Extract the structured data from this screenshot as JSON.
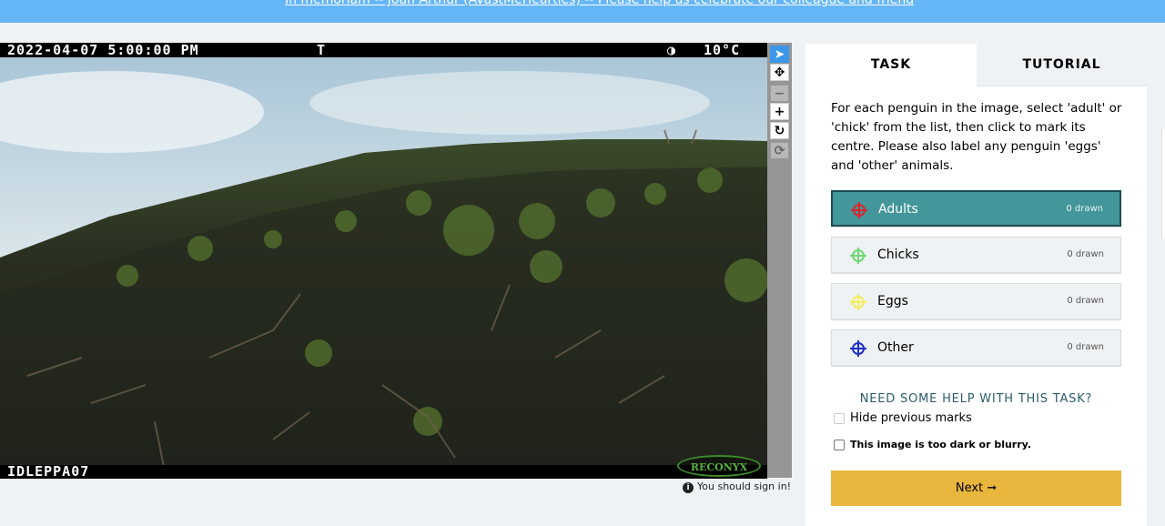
{
  "banner": {
    "text": "In memoriam -- Joan Arthur (AvastMeHearties) -- Please help us celebrate our colleague and friend",
    "suffix": "."
  },
  "viewer": {
    "timestamp": "2022-04-07 5:00:00 PM",
    "flag": "T",
    "moon_symbol": "◑",
    "temperature": "10°C",
    "camera_id": "IDLEPPA07",
    "camera_brand": "RECONYX"
  },
  "toolbar": {
    "tools": [
      {
        "name": "select-tool",
        "glyph": "➤"
      },
      {
        "name": "pan-tool",
        "glyph": "✥"
      },
      {
        "name": "zoom-out-tool",
        "glyph": "−"
      },
      {
        "name": "zoom-in-tool",
        "glyph": "+"
      },
      {
        "name": "rotate-tool",
        "glyph": "↻"
      },
      {
        "name": "reset-tool",
        "glyph": "⟳"
      }
    ]
  },
  "sign_in_notice": "You should sign in!",
  "tabs": {
    "task": "TASK",
    "tutorial": "TUTORIAL"
  },
  "task": {
    "instructions": "For each penguin in the image, select 'adult' or 'chick' from the list, then click to mark its centre. Please also label any penguin 'eggs' and 'other' animals.",
    "tools": [
      {
        "label": "Adults",
        "count": "0 drawn",
        "color": "#d9262e",
        "selected": true
      },
      {
        "label": "Chicks",
        "count": "0 drawn",
        "color": "#6ed873",
        "selected": false
      },
      {
        "label": "Eggs",
        "count": "0 drawn",
        "color": "#f2ee5c",
        "selected": false
      },
      {
        "label": "Other",
        "count": "0 drawn",
        "color": "#1f2fc9",
        "selected": false
      }
    ],
    "help_link": "NEED SOME HELP WITH THIS TASK?",
    "hide_marks_label": "Hide previous marks",
    "too_dark_label": "This image is too dark or blurry.",
    "next_label": "Next ➞"
  },
  "colors": {
    "banner": "#65b6f6",
    "selected_tool": "#43969a",
    "next_button": "#e8b63c"
  }
}
